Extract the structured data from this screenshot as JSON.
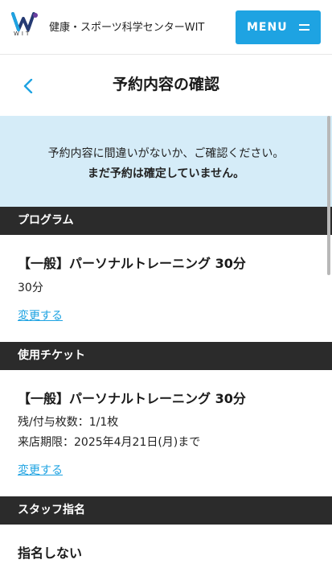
{
  "header": {
    "logo_text": "WIT",
    "site_name": "健康・スポーツ科学センターWIT",
    "menu_label": "MENU",
    "brand_colors": {
      "blue": "#1ea3e2",
      "navy": "#253a73",
      "purple": "#6a3fa0"
    }
  },
  "page": {
    "title": "予約内容の確認",
    "back_icon": "chevron-left-icon"
  },
  "notice": {
    "line1": "予約内容に間違いがないか、ご確認ください。",
    "line2": "まだ予約は確定していません。"
  },
  "sections": {
    "program": {
      "heading": "プログラム",
      "title": "【一般】パーソナルトレーニング 30分",
      "duration": "30分",
      "change_label": "変更する"
    },
    "ticket": {
      "heading": "使用チケット",
      "title": "【一般】パーソナルトレーニング 30分",
      "remaining": "残/付与枚数：1/1枚",
      "expiry": "来店期限：2025年4月21日(月)まで",
      "change_label": "変更する"
    },
    "staff": {
      "heading": "スタッフ指名",
      "value": "指名しない"
    }
  },
  "colors": {
    "accent": "#1ea3e2",
    "notice_bg": "#d5ecf8",
    "section_bg": "#2b2b2b"
  }
}
